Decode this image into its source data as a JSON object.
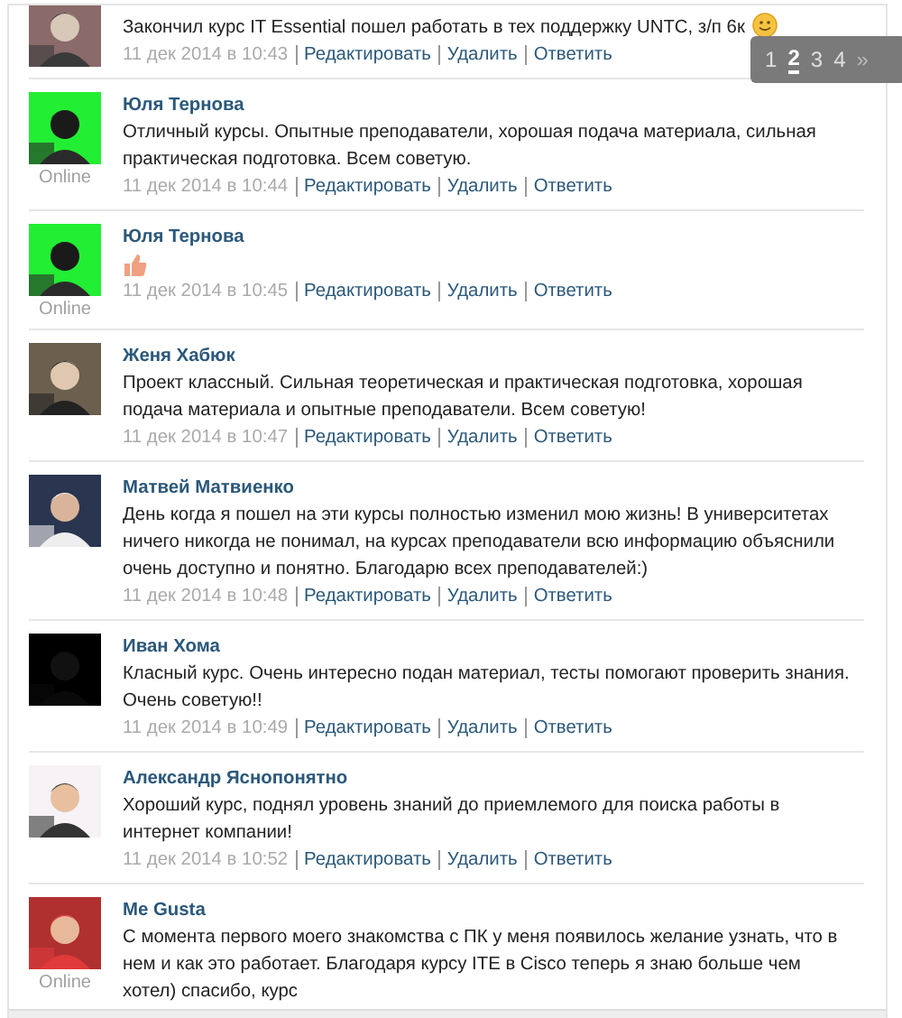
{
  "comments": [
    {
      "kind": "text",
      "text": "Закончил курс IT Essential пошел работать в тех поддержку UNTC, з/п 6к",
      "smiley": true,
      "date": "11 дек 2014 в 10:43",
      "actions": [
        "Редактировать",
        "Удалить",
        "Ответить"
      ]
    },
    {
      "name": "Юля Тернова",
      "status": "Online",
      "kind": "text",
      "text": "Отличный курсы. Опытные преподаватели, хорошая подача материала, сильная практическая подготовка. Всем советую.",
      "date": "11 дек 2014 в 10:44",
      "actions": [
        "Редактировать",
        "Удалить",
        "Ответить"
      ]
    },
    {
      "name": "Юля Тернова",
      "status": "Online",
      "kind": "sticker",
      "date": "11 дек 2014 в 10:45",
      "actions": [
        "Редактировать",
        "Удалить",
        "Ответить"
      ]
    },
    {
      "name": "Женя Хабюк",
      "kind": "text",
      "text": "Проект классный. Сильная теоретическая и практическая подготовка, хорошая подача материала и опытные преподаватели. Всем советую!",
      "date": "11 дек 2014 в 10:47",
      "actions": [
        "Редактировать",
        "Удалить",
        "Ответить"
      ]
    },
    {
      "name": "Матвей Матвиенко",
      "kind": "text",
      "text": "День когда я пошел на эти курсы полностью изменил мою жизнь! В университетах ничего никогда не понимал, на курсах преподаватели всю информацию объяснили очень доступно и понятно. Благодарю всех преподавателей:)",
      "date": "11 дек 2014 в 10:48",
      "actions": [
        "Редактировать",
        "Удалить",
        "Ответить"
      ]
    },
    {
      "name": "Иван Хома",
      "kind": "text",
      "text": "Класный курс. Очень интересно подан материал, тесты помогают проверить знания. Очень советую!!",
      "date": "11 дек 2014 в 10:49",
      "actions": [
        "Редактировать",
        "Удалить",
        "Ответить"
      ]
    },
    {
      "name": "Александр Яснопонятно",
      "kind": "text",
      "text": "Хороший курс, поднял уровень знаний до приемлемого для поиска работы в интернет компании!",
      "date": "11 дек 2014 в 10:52",
      "actions": [
        "Редактировать",
        "Удалить",
        "Ответить"
      ]
    },
    {
      "name": "Me Gusta",
      "status": "Online",
      "kind": "text",
      "text": "С момента первого моего знакомства с ПК у меня появилось желание узнать, что в нем и как это работает. Благодаря курсу ITE в Cisco теперь я знаю больше чем хотел) спасибо, курс"
    }
  ],
  "pagination": {
    "pages": [
      {
        "label": "1",
        "selected": false
      },
      {
        "label": "2",
        "selected": true
      },
      {
        "label": "3",
        "selected": false
      },
      {
        "label": "4",
        "selected": false
      }
    ],
    "next": "»"
  }
}
